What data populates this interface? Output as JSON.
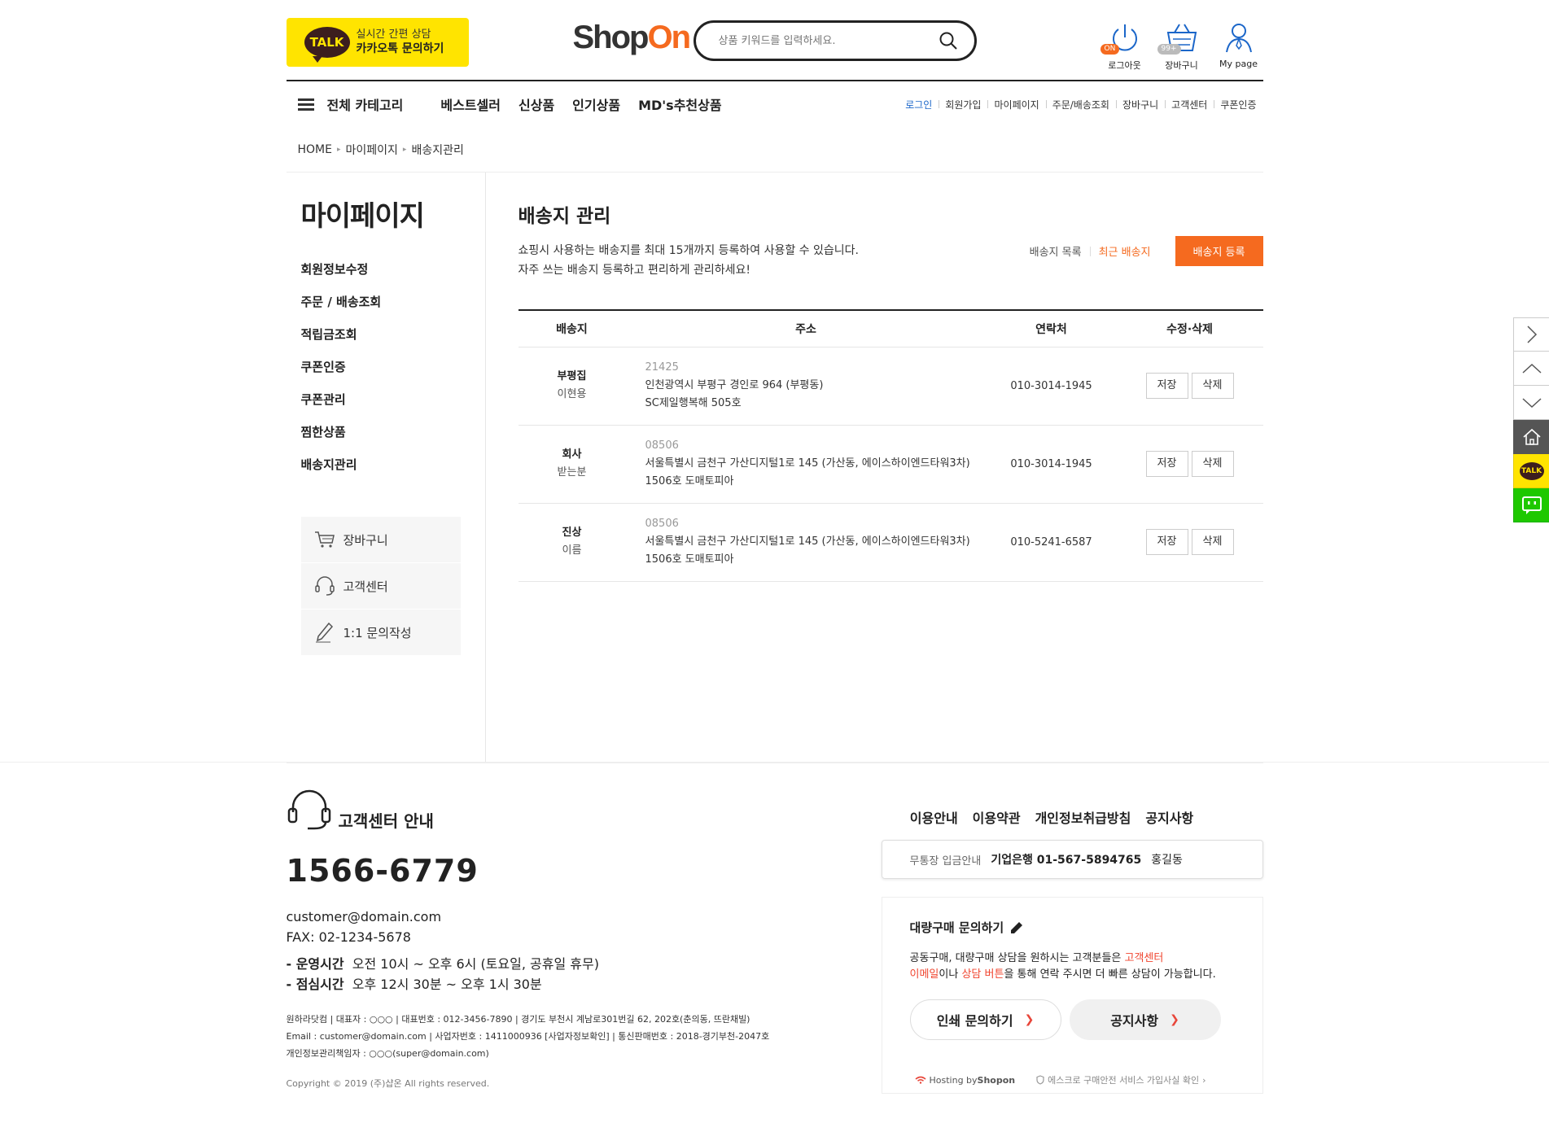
{
  "header": {
    "kakao": {
      "line1": "실시간 간편 상담",
      "line2": "카카오톡 문의하기",
      "talk": "TALK"
    },
    "logo": {
      "shop": "Shop",
      "on": "On"
    },
    "search": {
      "placeholder": "상품 키워드를 입력하세요."
    },
    "icons": [
      {
        "label": "로그아웃",
        "badge": "ON"
      },
      {
        "label": "장바구니",
        "badge": "99+"
      },
      {
        "label": "My page"
      }
    ]
  },
  "gnb": {
    "category": "전체 카테고리",
    "menu": [
      "베스트셀러",
      "신상품",
      "인기상품",
      "MD's추천상품"
    ],
    "util": [
      "로그인",
      "회원가입",
      "마이페이지",
      "주문/배송조회",
      "장바구니",
      "고객센터",
      "쿠폰인증"
    ]
  },
  "breadcrumb": [
    "HOME",
    "마이페이지",
    "배송지관리"
  ],
  "sidebar": {
    "title": "마이페이지",
    "items": [
      "회원정보수정",
      "주문 / 배송조회",
      "적립금조회",
      "쿠폰인증",
      "쿠폰관리",
      "찜한상품",
      "배송지관리"
    ],
    "box": [
      "장바구니",
      "고객센터",
      "1:1 문의작성"
    ]
  },
  "main": {
    "title": "배송지 관리",
    "desc1": "쇼핑시 사용하는 배송지를 최대 15개까지 등록하여 사용할 수 있습니다.",
    "desc2": "자주 쓰는 배송지 등록하고 편리하게 관리하세요!",
    "tabs": [
      "배송지 목록",
      "최근 배송지"
    ],
    "register": "배송지 등록",
    "columns": [
      "배송지",
      "주소",
      "연락처",
      "수정·삭제"
    ],
    "save_label": "저장",
    "delete_label": "삭제",
    "rows": [
      {
        "place": "부평집",
        "receiver": "이현용",
        "zip": "21425",
        "addr1": "인천광역시 부평구 경인로 964 (부평동)",
        "addr2": "SC제일행복해 505호",
        "phone": "010-3014-1945"
      },
      {
        "place": "회사",
        "receiver": "받는분",
        "zip": "08506",
        "addr1": "서울특별시 금천구 가산디지털1로 145 (가산동, 에이스하이엔드타워3차)",
        "addr2": "1506호 도매토피아",
        "phone": "010-3014-1945"
      },
      {
        "place": "진상",
        "receiver": "이름",
        "zip": "08506",
        "addr1": "서울특별시 금천구 가산디지털1로 145 (가산동, 에이스하이엔드타워3차)",
        "addr2": "1506호 도매토피아",
        "phone": "010-5241-6587"
      }
    ]
  },
  "footer": {
    "cs_title": "고객센터 안내",
    "phone": "1566-6779",
    "email": "customer@domain.com",
    "fax": "FAX: 02-1234-5678",
    "hours1_label": "- 운영시간",
    "hours1": "오전 10시 ~ 오후 6시 (토요일, 공휴일 휴무)",
    "hours2_label": "- 점심시간",
    "hours2": "오후 12시 30분 ~ 오후 1시 30분",
    "biz1": "원하라닷컴 | 대표자 : ○○○ | 대표번호 : 012-3456-7890 | 경기도 부천시 계남로301번길 62, 202호(춘의동, 뜨란채빌)",
    "biz2": "Email : customer@domain.com | 사업자번호 : 1411000936 [사업자정보확인] | 통신판매번호 : 2018-경기부천-2047호",
    "biz3": "개인정보관리책임자 : ○○○(super@domain.com)",
    "copyright": "Copyright © 2019 (주)샵온 All rights reserved.",
    "links": [
      "이용안내",
      "이용약관",
      "개인정보취급방침",
      "공지사항"
    ],
    "bank_label": "무통장 입금안내",
    "bank_account": "기업은행 01-567-5894765",
    "bank_holder": "홍길동",
    "bulk_title": "대량구매 문의하기",
    "bulk_p1a": "공동구매, 대량구매 상담을 원하시는 고객분들은 ",
    "bulk_p1b": "고객센터",
    "bulk_p2a": "이메일",
    "bulk_p2b": "이나 ",
    "bulk_p2c": "상담 버튼",
    "bulk_p2d": "을 통해 연락 주시면 더 빠른 상담이 가능합니다.",
    "btn_print": "인쇄 문의하기",
    "btn_notice": "공지사항",
    "hosting": "Hosting by ",
    "hosting_brand": "Shopon",
    "escrow": "에스크로 구매안전 서비스 가입사실 확인"
  },
  "quickbar": {
    "talk": "TALK"
  }
}
